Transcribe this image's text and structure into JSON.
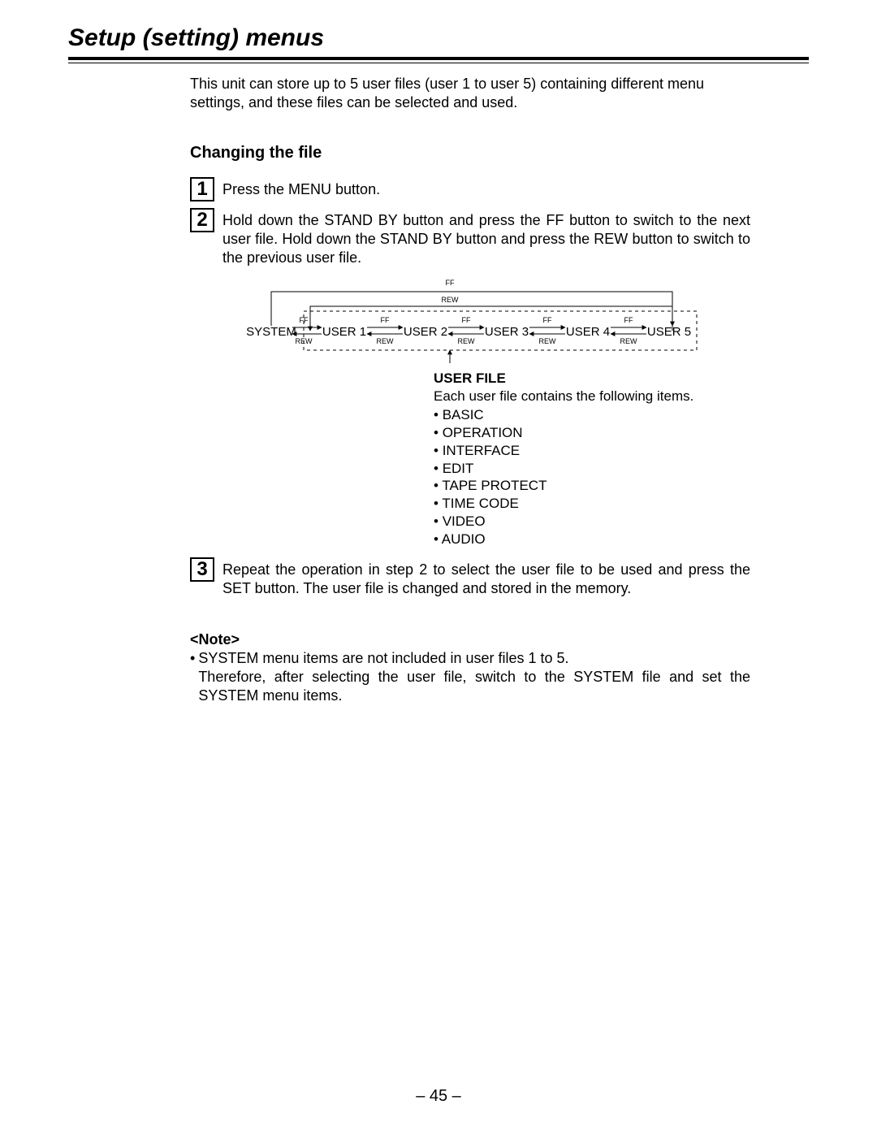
{
  "title": "Setup (setting) menus",
  "intro": "This unit can store up to 5 user files (user 1 to user 5) containing different menu settings, and these files can be selected and used.",
  "section_heading": "Changing the file",
  "steps": {
    "s1": {
      "num": "1",
      "text": "Press the MENU button."
    },
    "s2": {
      "num": "2",
      "text": "Hold down the STAND BY button and press the FF button to switch to the next user file. Hold down the STAND BY button and press the REW button to switch to the previous user file."
    },
    "s3": {
      "num": "3",
      "text": "Repeat the operation in step 2 to select the user file to be used and press the SET button. The user file is changed and stored in the memory."
    }
  },
  "diagram": {
    "top_ff": "FF",
    "rew": "REW",
    "ff": "FF",
    "nodes": [
      "SYSTEM",
      "USER 1",
      "USER 2",
      "USER 3",
      "USER 4",
      "USER 5"
    ]
  },
  "user_file": {
    "heading": "USER FILE",
    "intro": "Each user file contains the following items.",
    "items": [
      "BASIC",
      "OPERATION",
      "INTERFACE",
      "EDIT",
      "TAPE PROTECT",
      "TIME CODE",
      "VIDEO",
      "AUDIO"
    ]
  },
  "note": {
    "heading": "<Note>",
    "line1": "SYSTEM menu items are not included in user files 1 to 5.",
    "line2": "Therefore, after selecting the user file, switch to the SYSTEM file and set the SYSTEM menu items."
  },
  "page_number": "– 45 –"
}
